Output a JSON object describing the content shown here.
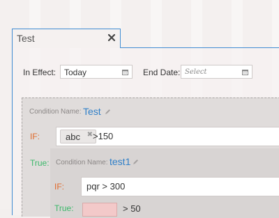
{
  "tab": {
    "title": "Test",
    "close_icon": "close-icon"
  },
  "effective": {
    "in_effect_label": "In Effect:",
    "in_effect_value": "Today",
    "end_date_label": "End Date:",
    "end_date_placeholder": "Select",
    "calendar_icon": "calendar-icon"
  },
  "condition": {
    "name_label": "Condition Name:",
    "name": "Test",
    "if_label": "IF:",
    "token": "abc",
    "expression": ">150",
    "true_label": "True:",
    "nested": {
      "name_label": "Condition Name:",
      "name": "test1",
      "if_label": "IF:",
      "expression": "pqr > 300",
      "true_label": "True:",
      "partial_expression": "> 50"
    }
  },
  "colors": {
    "accent_blue": "#2f7fc8",
    "if_orange": "#e06a2b",
    "true_green": "#3bb86a",
    "tab_border": "#3f8bd2"
  }
}
